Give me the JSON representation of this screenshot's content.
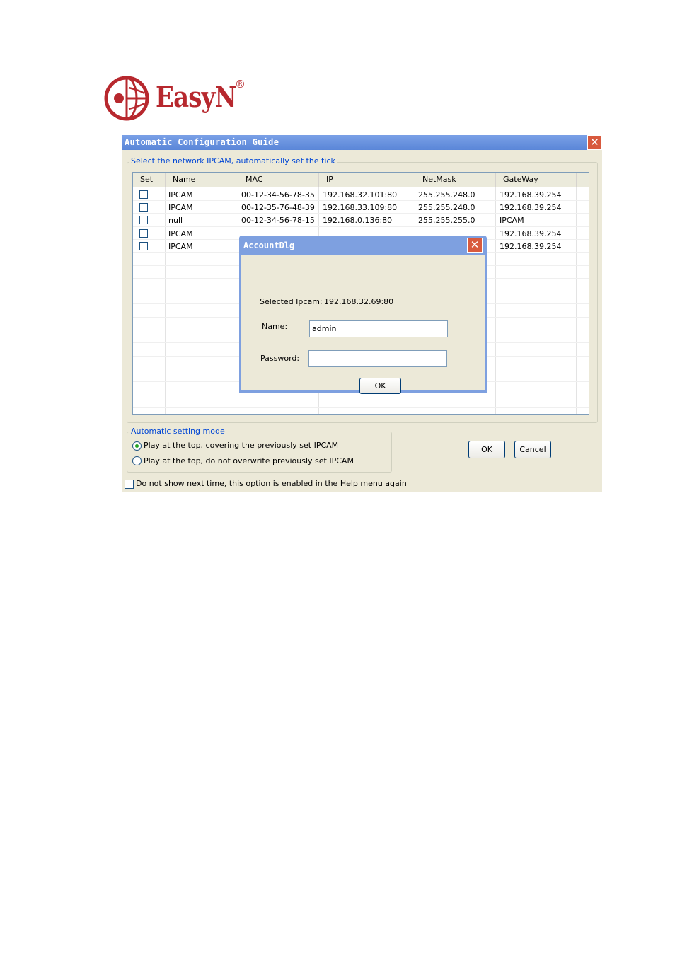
{
  "brand": {
    "name": "EasyN",
    "registered_mark": "®",
    "color": "#b7282e"
  },
  "window": {
    "title": "Automatic Configuration Guide",
    "close_icon": "close-icon"
  },
  "device_group": {
    "legend": "Select the network IPCAM, automatically set the tick"
  },
  "table": {
    "columns": [
      "Set",
      "Name",
      "MAC",
      "IP",
      "NetMask",
      "GateWay"
    ],
    "rows": [
      {
        "checked": false,
        "name": "IPCAM",
        "mac": "00-12-34-56-78-35",
        "ip": "192.168.32.101:80",
        "netmask": "255.255.248.0",
        "gateway": "192.168.39.254"
      },
      {
        "checked": false,
        "name": "IPCAM",
        "mac": "00-12-35-76-48-39",
        "ip": "192.168.33.109:80",
        "netmask": "255.255.248.0",
        "gateway": "192.168.39.254"
      },
      {
        "checked": false,
        "name": "null",
        "mac": "00-12-34-56-78-15",
        "ip": "192.168.0.136:80",
        "netmask": "255.255.255.0",
        "gateway": "IPCAM"
      },
      {
        "checked": false,
        "name": "IPCAM",
        "mac": "",
        "ip": "",
        "netmask": "",
        "gateway": "192.168.39.254"
      },
      {
        "checked": false,
        "name": "IPCAM",
        "mac": "",
        "ip": "",
        "netmask": "",
        "gateway": "192.168.39.254"
      }
    ]
  },
  "account_dialog": {
    "title": "AccountDlg",
    "selected_label": "Selected Ipcam:",
    "selected_value": "192.168.32.69:80",
    "name_label": "Name:",
    "name_value": "admin",
    "password_label": "Password:",
    "password_value": "",
    "ok_label": "OK"
  },
  "mode_group": {
    "legend": "Automatic setting mode",
    "options": [
      {
        "label": "Play at the top, covering the previously set IPCAM",
        "selected": true
      },
      {
        "label": "Play at the top, do not overwrite previously set IPCAM",
        "selected": false
      }
    ]
  },
  "buttons": {
    "ok": "OK",
    "cancel": "Cancel"
  },
  "dont_show": {
    "label": "Do not show next time, this option is enabled in the Help menu again",
    "checked": false
  }
}
